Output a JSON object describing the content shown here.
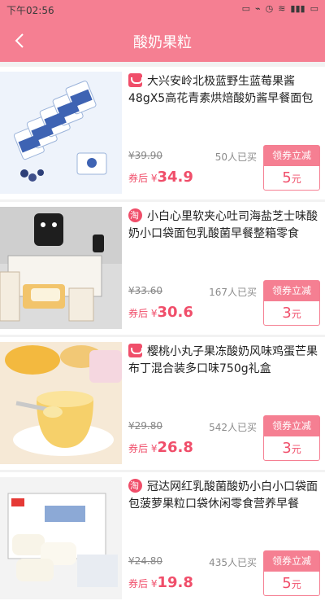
{
  "status_bar": {
    "time": "下午02:56"
  },
  "nav": {
    "title": "酸奶果粒"
  },
  "products": [
    {
      "name": "大兴安岭北极蓝野生蓝莓果酱48gX5高花青素烘焙酸奶酱早餐面包",
      "orig_price": "¥39.90",
      "sales": "50人已买",
      "after_label": "券后",
      "currency": "¥",
      "price": "34.9",
      "coupon_title": "领券立减",
      "coupon_amount": "5",
      "coupon_unit": "元",
      "shop": "tmall-icon"
    },
    {
      "name": "小白心里软夹心吐司海盐芝士味酸奶小口袋面包乳酸菌早餐整箱零食",
      "orig_price": "¥33.60",
      "sales": "167人已买",
      "after_label": "券后",
      "currency": "¥",
      "price": "30.6",
      "coupon_title": "领券立减",
      "coupon_amount": "3",
      "coupon_unit": "元",
      "shop": "taobao-icon"
    },
    {
      "name": "樱桃小丸子果冻酸奶风味鸡蛋芒果布丁混合装多口味750g礼盒",
      "orig_price": "¥29.80",
      "sales": "542人已买",
      "after_label": "券后",
      "currency": "¥",
      "price": "26.8",
      "coupon_title": "领券立减",
      "coupon_amount": "3",
      "coupon_unit": "元",
      "shop": "tmall-icon"
    },
    {
      "name": "冠达网红乳酸菌酸奶小白小口袋面包菠萝果粒口袋休闲零食营养早餐",
      "orig_price": "¥24.80",
      "sales": "435人已买",
      "after_label": "券后",
      "currency": "¥",
      "price": "19.8",
      "coupon_title": "领券立减",
      "coupon_amount": "5",
      "coupon_unit": "元",
      "shop": "taobao-icon"
    }
  ]
}
